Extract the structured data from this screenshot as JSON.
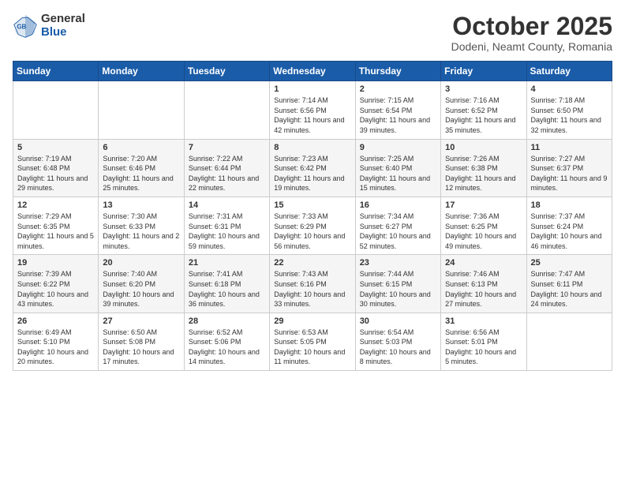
{
  "header": {
    "logo_general": "General",
    "logo_blue": "Blue",
    "month_title": "October 2025",
    "location": "Dodeni, Neamt County, Romania"
  },
  "weekdays": [
    "Sunday",
    "Monday",
    "Tuesday",
    "Wednesday",
    "Thursday",
    "Friday",
    "Saturday"
  ],
  "weeks": [
    [
      {
        "day": "",
        "info": ""
      },
      {
        "day": "",
        "info": ""
      },
      {
        "day": "",
        "info": ""
      },
      {
        "day": "1",
        "info": "Sunrise: 7:14 AM\nSunset: 6:56 PM\nDaylight: 11 hours and 42 minutes."
      },
      {
        "day": "2",
        "info": "Sunrise: 7:15 AM\nSunset: 6:54 PM\nDaylight: 11 hours and 39 minutes."
      },
      {
        "day": "3",
        "info": "Sunrise: 7:16 AM\nSunset: 6:52 PM\nDaylight: 11 hours and 35 minutes."
      },
      {
        "day": "4",
        "info": "Sunrise: 7:18 AM\nSunset: 6:50 PM\nDaylight: 11 hours and 32 minutes."
      }
    ],
    [
      {
        "day": "5",
        "info": "Sunrise: 7:19 AM\nSunset: 6:48 PM\nDaylight: 11 hours and 29 minutes."
      },
      {
        "day": "6",
        "info": "Sunrise: 7:20 AM\nSunset: 6:46 PM\nDaylight: 11 hours and 25 minutes."
      },
      {
        "day": "7",
        "info": "Sunrise: 7:22 AM\nSunset: 6:44 PM\nDaylight: 11 hours and 22 minutes."
      },
      {
        "day": "8",
        "info": "Sunrise: 7:23 AM\nSunset: 6:42 PM\nDaylight: 11 hours and 19 minutes."
      },
      {
        "day": "9",
        "info": "Sunrise: 7:25 AM\nSunset: 6:40 PM\nDaylight: 11 hours and 15 minutes."
      },
      {
        "day": "10",
        "info": "Sunrise: 7:26 AM\nSunset: 6:38 PM\nDaylight: 11 hours and 12 minutes."
      },
      {
        "day": "11",
        "info": "Sunrise: 7:27 AM\nSunset: 6:37 PM\nDaylight: 11 hours and 9 minutes."
      }
    ],
    [
      {
        "day": "12",
        "info": "Sunrise: 7:29 AM\nSunset: 6:35 PM\nDaylight: 11 hours and 5 minutes."
      },
      {
        "day": "13",
        "info": "Sunrise: 7:30 AM\nSunset: 6:33 PM\nDaylight: 11 hours and 2 minutes."
      },
      {
        "day": "14",
        "info": "Sunrise: 7:31 AM\nSunset: 6:31 PM\nDaylight: 10 hours and 59 minutes."
      },
      {
        "day": "15",
        "info": "Sunrise: 7:33 AM\nSunset: 6:29 PM\nDaylight: 10 hours and 56 minutes."
      },
      {
        "day": "16",
        "info": "Sunrise: 7:34 AM\nSunset: 6:27 PM\nDaylight: 10 hours and 52 minutes."
      },
      {
        "day": "17",
        "info": "Sunrise: 7:36 AM\nSunset: 6:25 PM\nDaylight: 10 hours and 49 minutes."
      },
      {
        "day": "18",
        "info": "Sunrise: 7:37 AM\nSunset: 6:24 PM\nDaylight: 10 hours and 46 minutes."
      }
    ],
    [
      {
        "day": "19",
        "info": "Sunrise: 7:39 AM\nSunset: 6:22 PM\nDaylight: 10 hours and 43 minutes."
      },
      {
        "day": "20",
        "info": "Sunrise: 7:40 AM\nSunset: 6:20 PM\nDaylight: 10 hours and 39 minutes."
      },
      {
        "day": "21",
        "info": "Sunrise: 7:41 AM\nSunset: 6:18 PM\nDaylight: 10 hours and 36 minutes."
      },
      {
        "day": "22",
        "info": "Sunrise: 7:43 AM\nSunset: 6:16 PM\nDaylight: 10 hours and 33 minutes."
      },
      {
        "day": "23",
        "info": "Sunrise: 7:44 AM\nSunset: 6:15 PM\nDaylight: 10 hours and 30 minutes."
      },
      {
        "day": "24",
        "info": "Sunrise: 7:46 AM\nSunset: 6:13 PM\nDaylight: 10 hours and 27 minutes."
      },
      {
        "day": "25",
        "info": "Sunrise: 7:47 AM\nSunset: 6:11 PM\nDaylight: 10 hours and 24 minutes."
      }
    ],
    [
      {
        "day": "26",
        "info": "Sunrise: 6:49 AM\nSunset: 5:10 PM\nDaylight: 10 hours and 20 minutes."
      },
      {
        "day": "27",
        "info": "Sunrise: 6:50 AM\nSunset: 5:08 PM\nDaylight: 10 hours and 17 minutes."
      },
      {
        "day": "28",
        "info": "Sunrise: 6:52 AM\nSunset: 5:06 PM\nDaylight: 10 hours and 14 minutes."
      },
      {
        "day": "29",
        "info": "Sunrise: 6:53 AM\nSunset: 5:05 PM\nDaylight: 10 hours and 11 minutes."
      },
      {
        "day": "30",
        "info": "Sunrise: 6:54 AM\nSunset: 5:03 PM\nDaylight: 10 hours and 8 minutes."
      },
      {
        "day": "31",
        "info": "Sunrise: 6:56 AM\nSunset: 5:01 PM\nDaylight: 10 hours and 5 minutes."
      },
      {
        "day": "",
        "info": ""
      }
    ]
  ]
}
